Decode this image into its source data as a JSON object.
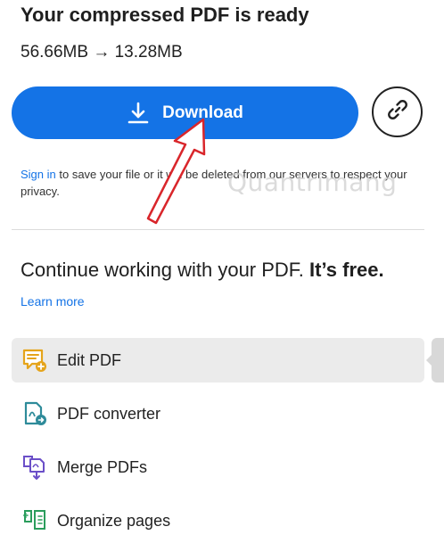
{
  "header": {
    "title": "Your compressed PDF is ready",
    "size_info": "56.66MB → 13.28MB"
  },
  "actions": {
    "download_label": "Download",
    "download_icon": "download-icon",
    "share_icon": "link-icon"
  },
  "notice": {
    "sign_in_link": "Sign in",
    "text": " to save your file or it will be deleted from our servers to respect your privacy."
  },
  "watermark": "Quantrimang",
  "continue_section": {
    "heading": "Continue working with your PDF.",
    "heading_strong": "It’s free.",
    "learn_more": "Learn more"
  },
  "tools": [
    {
      "label": "Edit PDF",
      "icon": "edit-pdf-icon",
      "active": true
    },
    {
      "label": "PDF converter",
      "icon": "pdf-converter-icon",
      "active": false
    },
    {
      "label": "Merge PDFs",
      "icon": "merge-pdfs-icon",
      "active": false
    },
    {
      "label": "Organize pages",
      "icon": "organize-pages-icon",
      "active": false
    }
  ],
  "colors": {
    "accent": "#1473e6",
    "annotation": "#d9262b"
  }
}
